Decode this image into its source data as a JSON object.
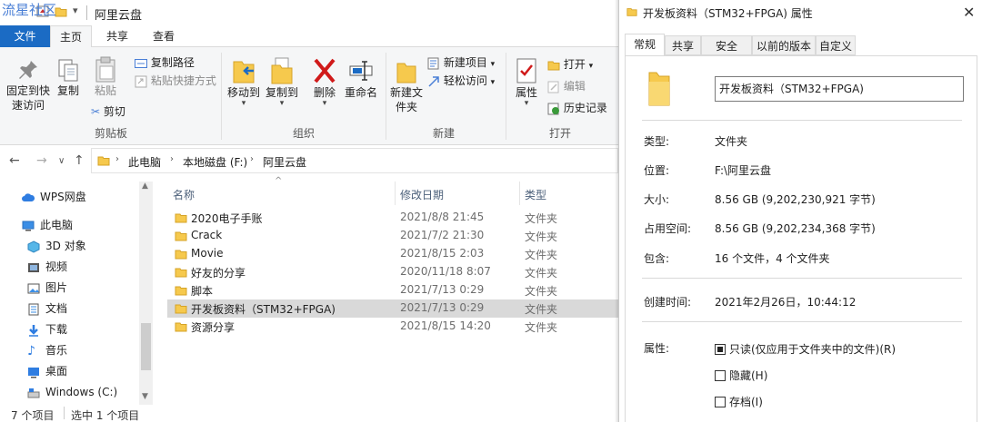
{
  "watermark": "流星社区",
  "explorer": {
    "title": "阿里云盘",
    "ribbon_tabs": [
      "文件",
      "主页",
      "共享",
      "查看"
    ],
    "clipboard": {
      "pin": "固定到快速访问",
      "copy": "复制",
      "paste": "粘贴",
      "copy_path": "复制路径",
      "paste_shortcut": "粘贴快捷方式",
      "cut": "剪切",
      "label": "剪贴板"
    },
    "organize": {
      "move_to": "移动到",
      "copy_to": "复制到",
      "delete": "删除",
      "rename": "重命名",
      "label": "组织"
    },
    "new": {
      "new_folder": "新建文件夹",
      "new_item": "新建项目",
      "easy_access": "轻松访问",
      "label": "新建"
    },
    "open": {
      "properties": "属性",
      "open": "打开",
      "edit": "编辑",
      "history": "历史记录",
      "label": "打开"
    },
    "breadcrumb": [
      "此电脑",
      "本地磁盘 (F:)",
      "阿里云盘"
    ],
    "nav_items": [
      {
        "label": "WPS网盘",
        "icon": "cloud-icon"
      },
      {
        "label": "此电脑",
        "icon": "computer-icon"
      },
      {
        "label": "3D 对象",
        "icon": "cube-icon"
      },
      {
        "label": "视频",
        "icon": "video-icon"
      },
      {
        "label": "图片",
        "icon": "picture-icon"
      },
      {
        "label": "文档",
        "icon": "document-icon"
      },
      {
        "label": "下载",
        "icon": "download-icon"
      },
      {
        "label": "音乐",
        "icon": "music-icon"
      },
      {
        "label": "桌面",
        "icon": "desktop-icon"
      },
      {
        "label": "Windows (C:)",
        "icon": "drive-icon"
      }
    ],
    "columns": [
      "名称",
      "修改日期",
      "类型"
    ],
    "files": [
      {
        "name": "2020电子手账",
        "date": "2021/8/8 21:45",
        "type": "文件夹"
      },
      {
        "name": "Crack",
        "date": "2021/7/2 21:30",
        "type": "文件夹"
      },
      {
        "name": "Movie",
        "date": "2021/8/15 2:03",
        "type": "文件夹"
      },
      {
        "name": "好友的分享",
        "date": "2020/11/18 8:07",
        "type": "文件夹"
      },
      {
        "name": "脚本",
        "date": "2021/7/13 0:29",
        "type": "文件夹"
      },
      {
        "name": "开发板资料（STM32+FPGA)",
        "date": "2021/7/13 0:29",
        "type": "文件夹"
      },
      {
        "name": "资源分享",
        "date": "2021/8/15 14:20",
        "type": "文件夹"
      }
    ],
    "status": {
      "count": "7 个项目",
      "selected": "选中 1 个项目"
    }
  },
  "properties": {
    "title": "开发板资料（STM32+FPGA)   属性",
    "tabs": [
      "常规",
      "共享",
      "安全",
      "以前的版本",
      "自定义"
    ],
    "name": "开发板资料（STM32+FPGA)",
    "fields": {
      "type_label": "类型:",
      "type_value": "文件夹",
      "location_label": "位置:",
      "location_value": "F:\\阿里云盘",
      "size_label": "大小:",
      "size_value": "8.56 GB (9,202,230,921 字节)",
      "disk_label": "占用空间:",
      "disk_value": "8.56 GB (9,202,234,368 字节)",
      "contains_label": "包含:",
      "contains_value": "16 个文件，4 个文件夹",
      "created_label": "创建时间:",
      "created_value": "2021年2月26日，10:44:12",
      "attr_label": "属性:"
    },
    "attributes": {
      "readonly": "只读(仅应用于文件夹中的文件)(R)",
      "hidden": "隐藏(H)",
      "archive": "存档(I)"
    }
  }
}
